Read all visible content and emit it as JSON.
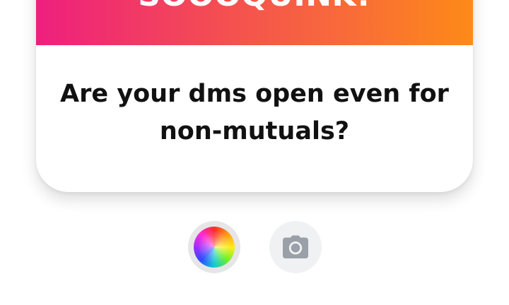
{
  "card": {
    "header_title": "SOOOQUINK!",
    "question": "Are your dms open even for non-mutuals?"
  },
  "colors": {
    "gradient_start": "#ee1f7e",
    "gradient_end": "#fd8a17",
    "question_text": "#111111",
    "button_bg": "#f0f1f3",
    "icon_gray": "#9aa0a8"
  },
  "controls": {
    "color_button_icon": "color-wheel-icon",
    "camera_button_icon": "camera-icon"
  }
}
